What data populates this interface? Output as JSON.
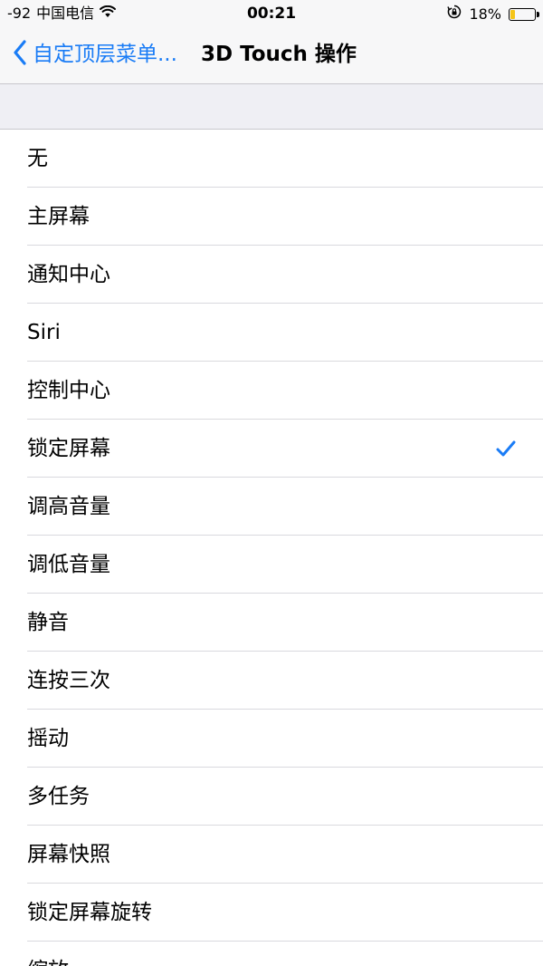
{
  "status_bar": {
    "signal": "-92",
    "carrier": "中国电信",
    "time": "00:21",
    "battery_percent": "18%",
    "battery_level": 0.18,
    "battery_color": "#f5c518"
  },
  "nav": {
    "back_label": "自定顶层菜单...",
    "title": "3D Touch 操作",
    "accent_color": "#1a7cf6"
  },
  "options": [
    {
      "label": "无",
      "selected": false
    },
    {
      "label": "主屏幕",
      "selected": false
    },
    {
      "label": "通知中心",
      "selected": false
    },
    {
      "label": "Siri",
      "selected": false
    },
    {
      "label": "控制中心",
      "selected": false
    },
    {
      "label": "锁定屏幕",
      "selected": true
    },
    {
      "label": "调高音量",
      "selected": false
    },
    {
      "label": "调低音量",
      "selected": false
    },
    {
      "label": "静音",
      "selected": false
    },
    {
      "label": "连按三次",
      "selected": false
    },
    {
      "label": "摇动",
      "selected": false
    },
    {
      "label": "多任务",
      "selected": false
    },
    {
      "label": "屏幕快照",
      "selected": false
    },
    {
      "label": "锁定屏幕旋转",
      "selected": false
    },
    {
      "label": "缩放",
      "selected": false
    }
  ],
  "icons": {
    "wifi": "wifi-icon",
    "lock_rotation": "orientation-lock-icon",
    "battery": "battery-icon",
    "back": "chevron-left-icon",
    "selected": "checkmark-icon"
  }
}
